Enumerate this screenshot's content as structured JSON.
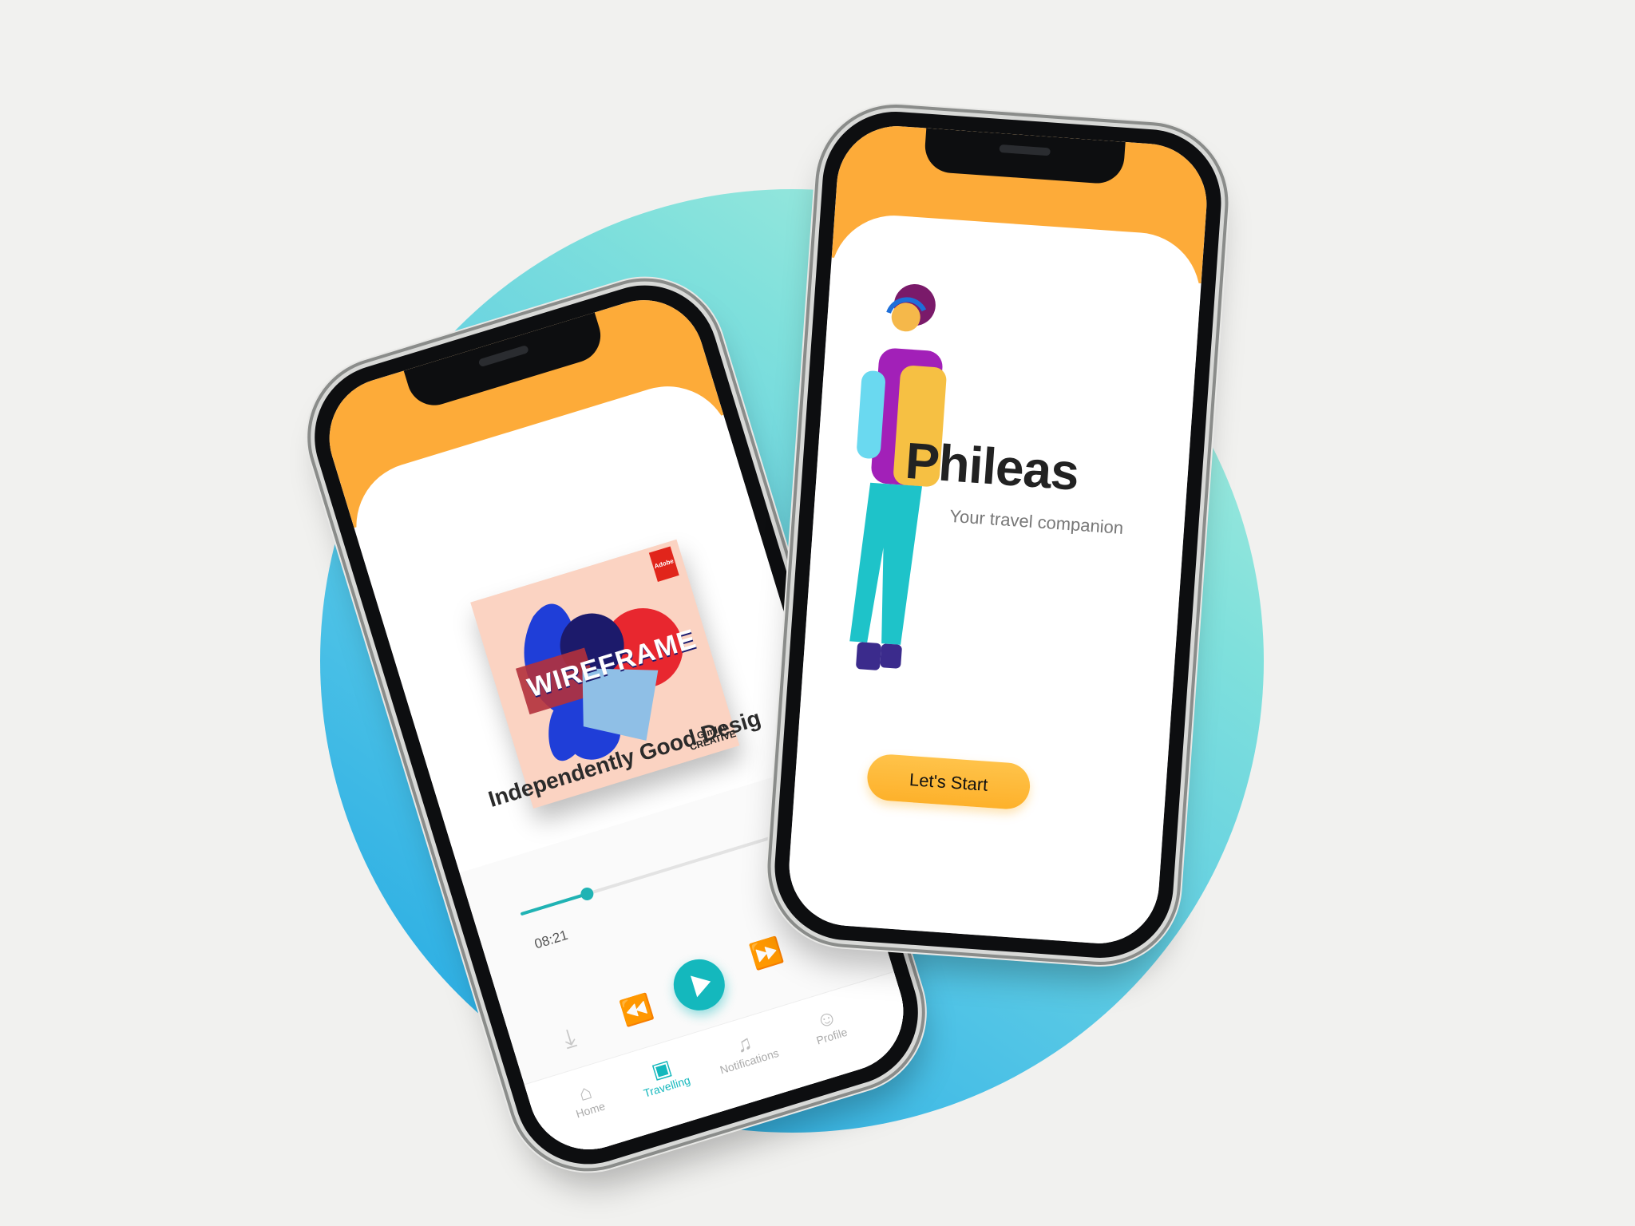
{
  "player_app": {
    "cover_brand": "WIREFRAME",
    "cover_badge": "Adobe",
    "cover_publisher": "Gimlet CREATIVE",
    "episode_title": "Independently Good Desig",
    "elapsed_time": "08:21",
    "progress": 0.23,
    "tabs": [
      {
        "label": "Home",
        "icon": "home-icon",
        "active": false
      },
      {
        "label": "Travelling",
        "icon": "luggage-icon",
        "active": true
      },
      {
        "label": "Notifications",
        "icon": "bell-icon",
        "active": false
      },
      {
        "label": "Profile",
        "icon": "person-icon",
        "active": false
      }
    ],
    "controls": [
      "download-icon",
      "rewind-icon",
      "play-icon",
      "fast-forward-icon"
    ]
  },
  "welcome_app": {
    "title": "Phileas",
    "subtitle": "Your travel companion",
    "cta_label": "Let's Start"
  },
  "colors": {
    "accent_orange": "#fdab39",
    "accent_teal": "#14b8bd",
    "button_yellow": "#fdb12b"
  }
}
